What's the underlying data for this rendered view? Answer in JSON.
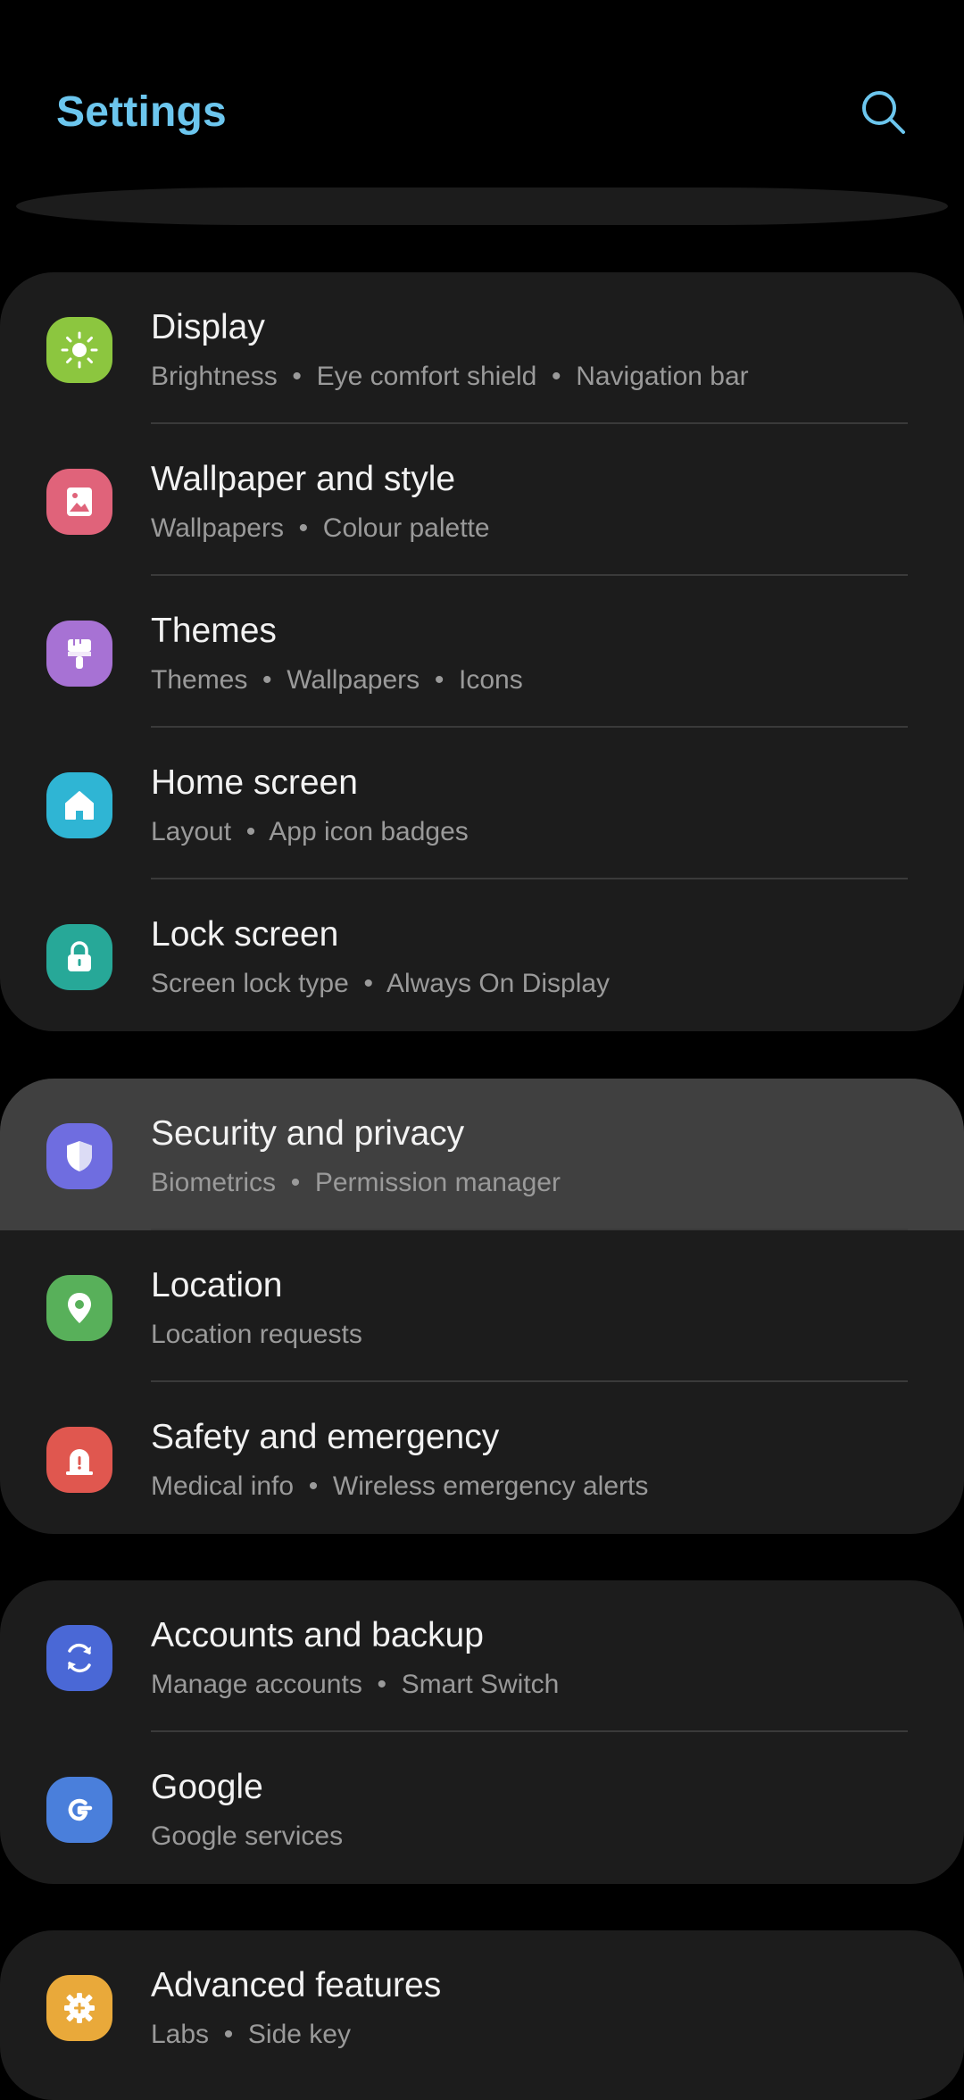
{
  "header": {
    "title": "Settings",
    "search_icon": "search-icon",
    "accent_color": "#6cc6ee"
  },
  "groups": [
    {
      "items": [
        {
          "title": "Display",
          "subtitle": "Brightness  •  Eye comfort shield  •  Navigation bar",
          "icon": "sun-icon",
          "color": "#8cc63f"
        },
        {
          "title": "Wallpaper and style",
          "subtitle": "Wallpapers  •  Colour palette",
          "icon": "picture-icon",
          "color": "#e0637a"
        },
        {
          "title": "Themes",
          "subtitle": "Themes  •  Wallpapers  •  Icons",
          "icon": "paintbrush-icon",
          "color": "#a772d4"
        },
        {
          "title": "Home screen",
          "subtitle": "Layout  •  App icon badges",
          "icon": "home-icon",
          "color": "#2fb5d4"
        },
        {
          "title": "Lock screen",
          "subtitle": "Screen lock type  •  Always On Display",
          "icon": "lock-icon",
          "color": "#27a898"
        }
      ]
    },
    {
      "items": [
        {
          "title": "Security and privacy",
          "subtitle": "Biometrics  •  Permission manager",
          "icon": "shield-icon",
          "color": "#6f6de0",
          "highlighted": true
        },
        {
          "title": "Location",
          "subtitle": "Location requests",
          "icon": "location-pin-icon",
          "color": "#58b05a"
        },
        {
          "title": "Safety and emergency",
          "subtitle": "Medical info  •  Wireless emergency alerts",
          "icon": "emergency-icon",
          "color": "#e0574f"
        }
      ]
    },
    {
      "items": [
        {
          "title": "Accounts and backup",
          "subtitle": "Manage accounts  •  Smart Switch",
          "icon": "sync-icon",
          "color": "#4a68d6"
        },
        {
          "title": "Google",
          "subtitle": "Google services",
          "icon": "google-icon",
          "color": "#4a7fdb"
        }
      ]
    },
    {
      "items": [
        {
          "title": "Advanced features",
          "subtitle": "Labs  •  Side key",
          "icon": "gear-plus-icon",
          "color": "#e9a93a"
        }
      ]
    }
  ]
}
